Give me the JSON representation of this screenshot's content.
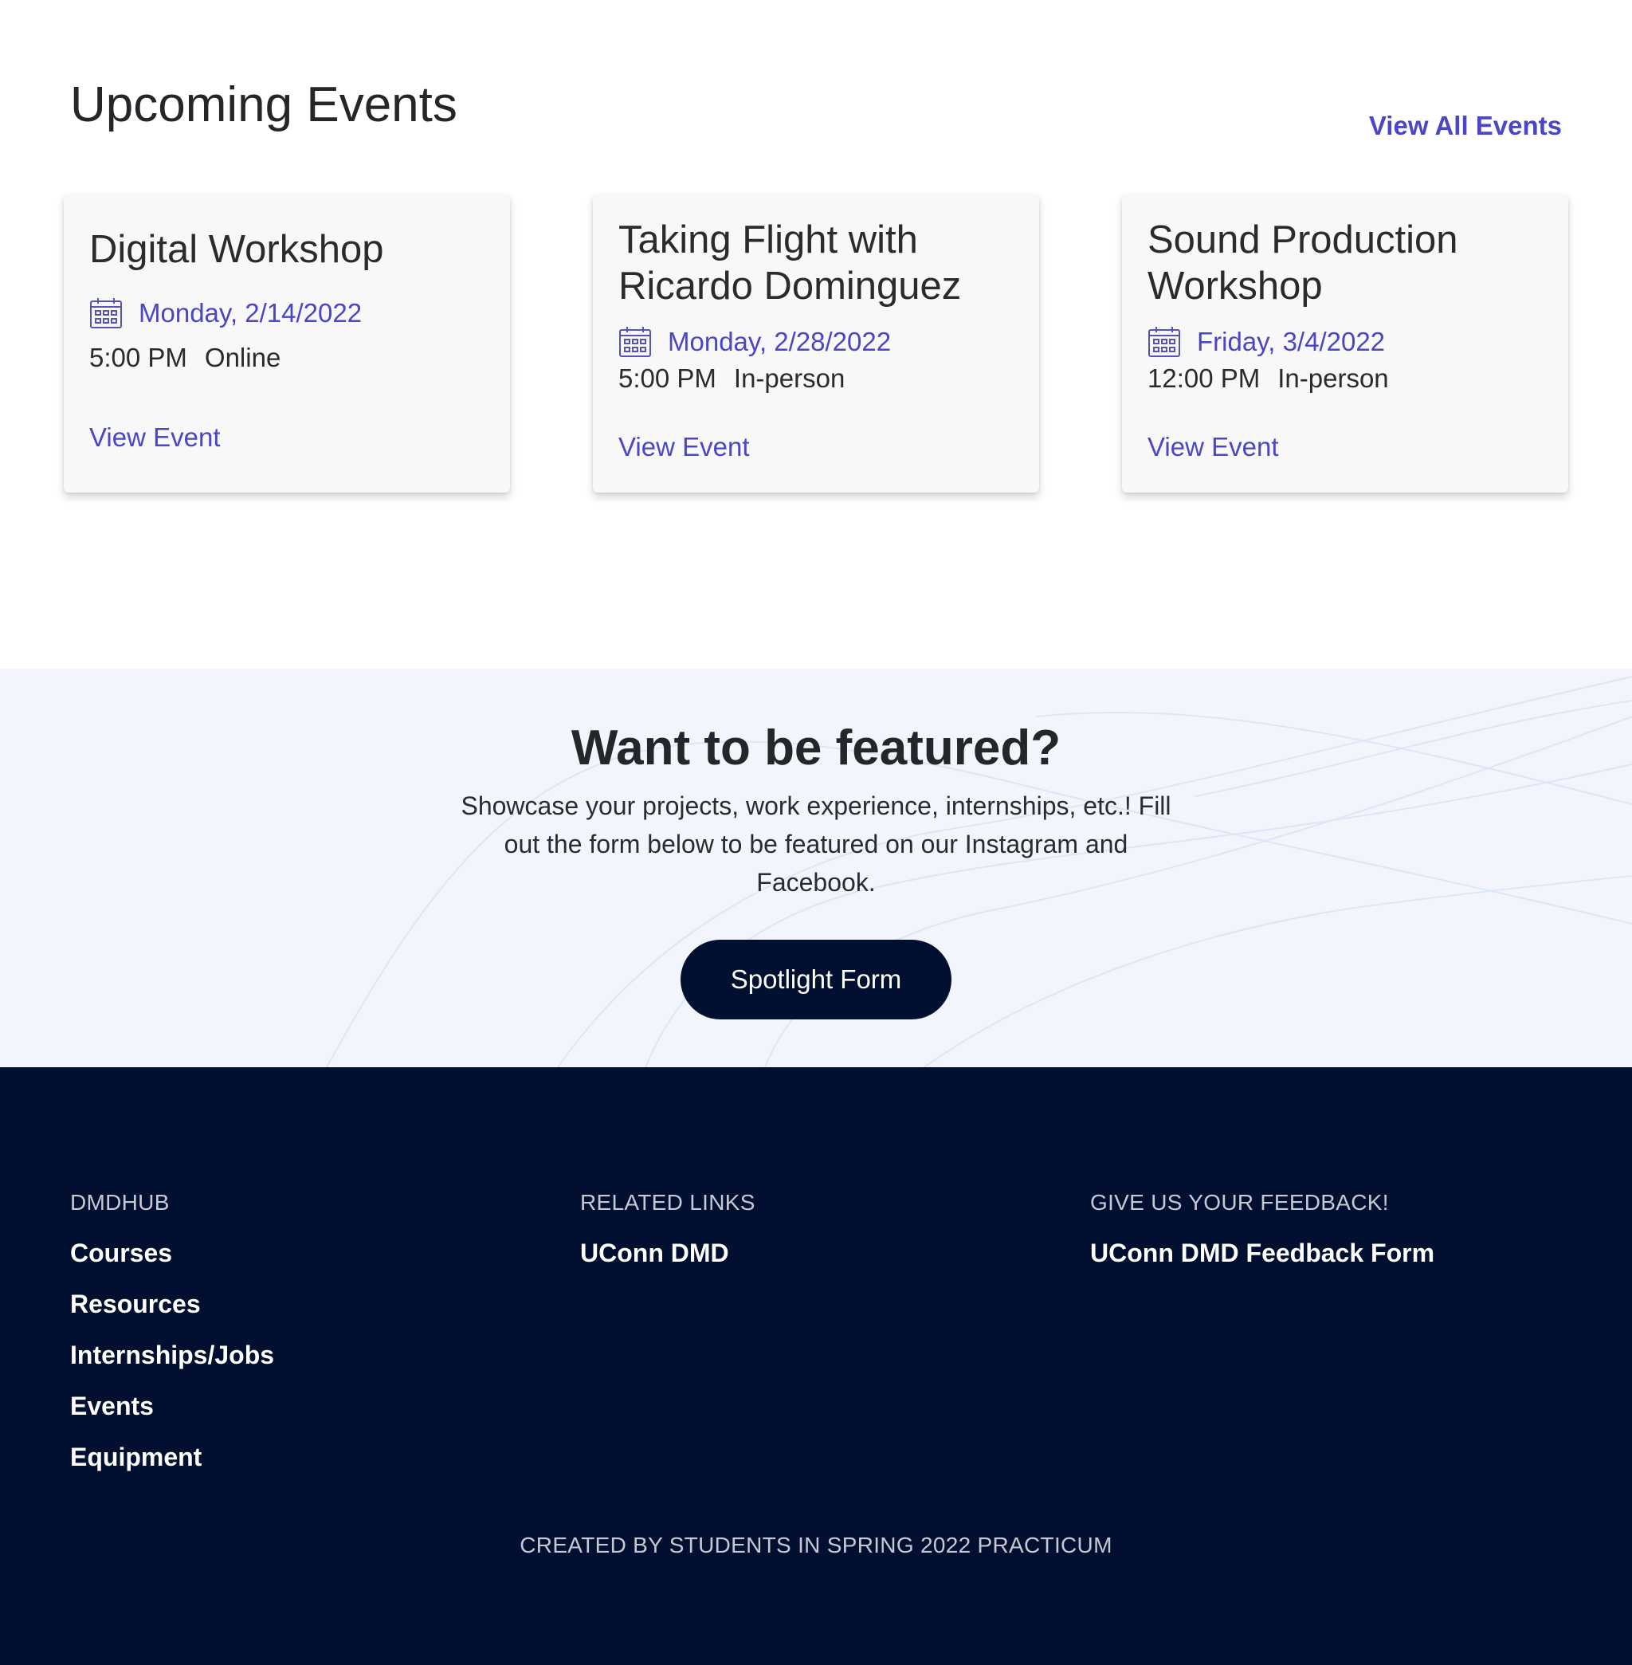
{
  "events": {
    "title": "Upcoming Events",
    "view_all_label": "View All Events",
    "cards": [
      {
        "name": "Digital Workshop",
        "date": "Monday, 2/14/2022",
        "time": "5:00 PM",
        "location": "Online",
        "link_label": "View Event",
        "icon": "calendar-icon"
      },
      {
        "name": "Taking Flight with Ricardo Dominguez",
        "date": "Monday, 2/28/2022",
        "time": "5:00 PM",
        "location": "In-person",
        "link_label": "View Event",
        "icon": "calendar-icon"
      },
      {
        "name": "Sound Production Workshop",
        "date": "Friday, 3/4/2022",
        "time": "12:00 PM",
        "location": "In-person",
        "link_label": "View Event",
        "icon": "calendar-icon"
      }
    ]
  },
  "featured": {
    "title": "Want to be featured?",
    "text": "Showcase your projects, work experience, internships, etc.! Fill out the form below to be featured on our Instagram and Facebook.",
    "button_label": "Spotlight Form"
  },
  "footer": {
    "columns": [
      {
        "heading": "DMDHUB",
        "links": [
          "Courses",
          "Resources",
          "Internships/Jobs",
          "Events",
          "Equipment"
        ]
      },
      {
        "heading": "RELATED LINKS",
        "links": [
          "UConn DMD"
        ]
      },
      {
        "heading": "GIVE US YOUR FEEDBACK!",
        "links": [
          "UConn DMD Feedback Form"
        ]
      }
    ],
    "credit": "CREATED BY STUDENTS IN SPRING 2022 PRACTICUM"
  },
  "colors": {
    "accent": "#4a46c4",
    "navy": "#011030",
    "card_bg": "#f8f8f8",
    "featured_bg": "#f2f6fc"
  }
}
